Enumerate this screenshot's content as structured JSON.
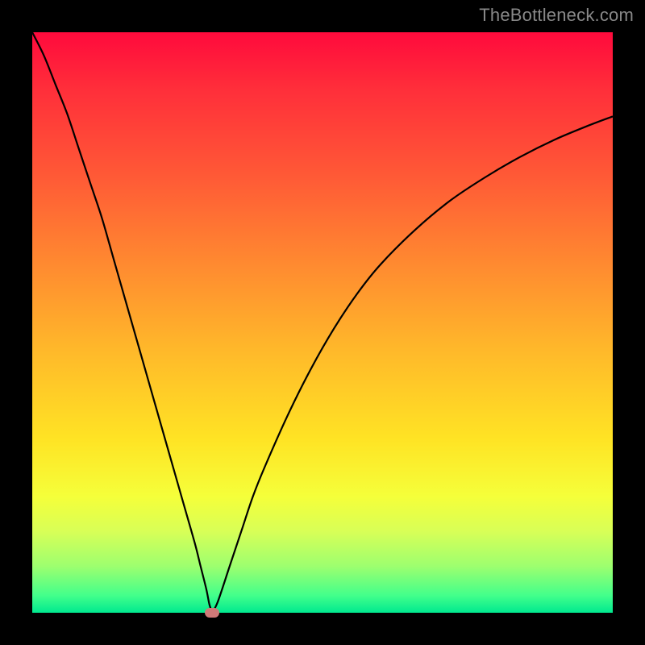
{
  "watermark": "TheBottleneck.com",
  "chart_data": {
    "type": "line",
    "title": "",
    "xlabel": "",
    "ylabel": "",
    "xlim": [
      0,
      100
    ],
    "ylim": [
      0,
      100
    ],
    "background_gradient": {
      "top": "#ff0a3c",
      "bottom": "#00e98f",
      "meaning": "high-to-low bottleneck percentage (red=high, green=low)"
    },
    "series": [
      {
        "name": "bottleneck-curve",
        "x": [
          0,
          2,
          4,
          6,
          8,
          10,
          12,
          14,
          16,
          18,
          20,
          22,
          24,
          26,
          28,
          29,
          30,
          30.5,
          31,
          32,
          34,
          36,
          38,
          40,
          44,
          48,
          52,
          56,
          60,
          66,
          72,
          78,
          84,
          90,
          96,
          100
        ],
        "y": [
          100,
          96,
          91,
          86,
          80,
          74,
          68,
          61,
          54,
          47,
          40,
          33,
          26,
          19,
          12,
          8,
          4,
          1.5,
          0,
          2,
          8,
          14,
          20,
          25,
          34,
          42,
          49,
          55,
          60,
          66,
          71,
          75,
          78.5,
          81.5,
          84,
          85.5
        ]
      }
    ],
    "marker": {
      "name": "min-bottleneck-marker",
      "x": 31,
      "y": 0,
      "color": "#cf7a78"
    }
  }
}
